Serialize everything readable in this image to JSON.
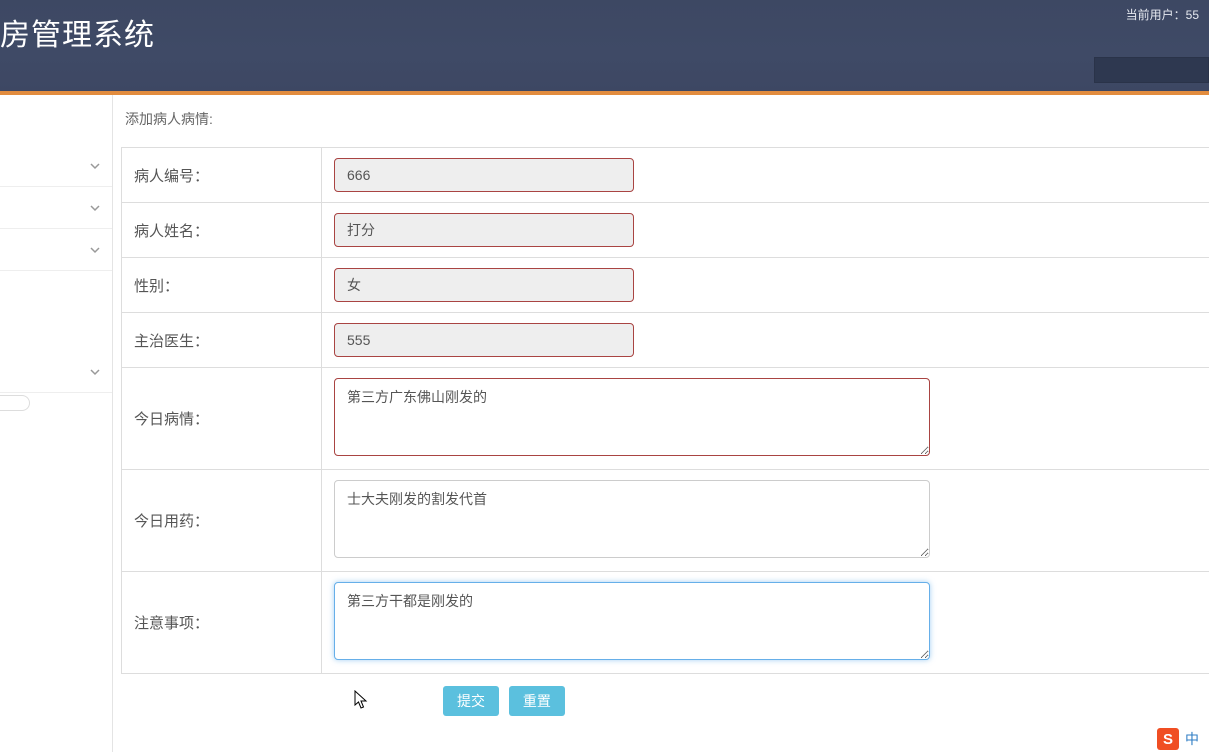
{
  "header": {
    "title": "房管理系统",
    "current_user_label": "当前用户：55"
  },
  "form": {
    "title": "添加病人病情:",
    "fields": {
      "patient_id": {
        "label": "病人编号：",
        "value": "666"
      },
      "patient_name": {
        "label": "病人姓名：",
        "value": "打分"
      },
      "gender": {
        "label": "性别：",
        "value": "女"
      },
      "doctor": {
        "label": "主治医生：",
        "value": "555"
      },
      "today_condition": {
        "label": "今日病情：",
        "value": "第三方广东佛山刚发的"
      },
      "today_medicine": {
        "label": "今日用药：",
        "value": "士大夫刚发的割发代首"
      },
      "notes": {
        "label": "注意事项：",
        "value": "第三方干都是刚发的"
      }
    },
    "buttons": {
      "submit": "提交",
      "reset": "重置"
    }
  },
  "ime": {
    "icon_letter": "S",
    "lang": "中"
  }
}
